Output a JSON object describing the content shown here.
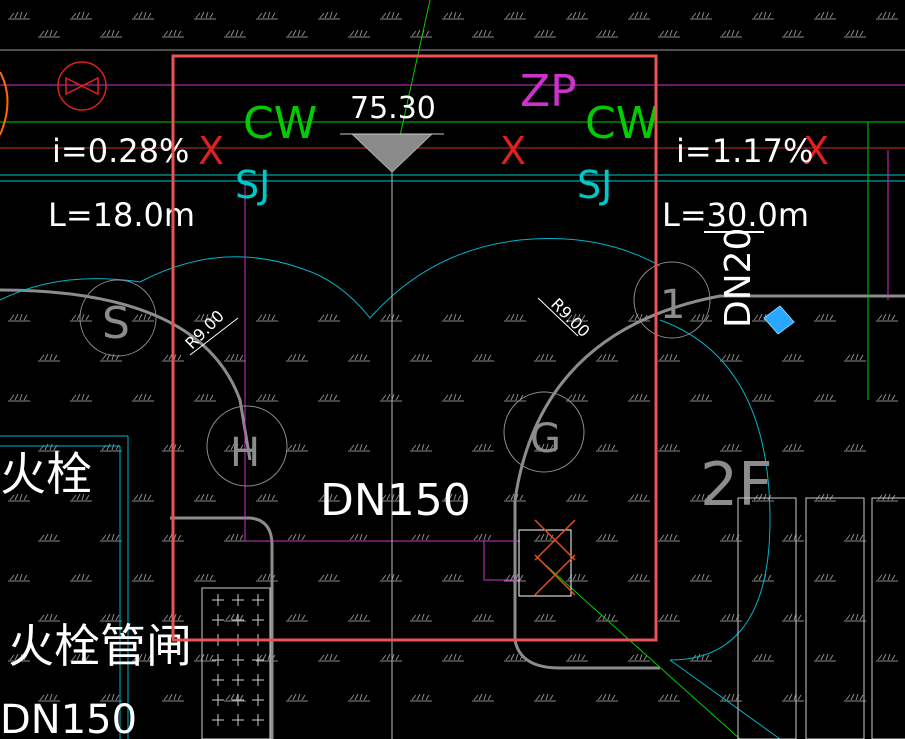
{
  "drawing": {
    "labels": {
      "zp": "ZP",
      "cw_left": "CW",
      "cw_right": "CW",
      "sj_left": "SJ",
      "sj_right": "SJ",
      "elevation": "75.30",
      "slope_left": "i=0.28%",
      "slope_right": "i=1.17%",
      "length_left": "L=18.0m",
      "length_right": "L=30.0m",
      "pipe_dn150": "DN150",
      "pipe_dn150_bottom": "DN150",
      "pipe_dn_vertical": "DN20",
      "radius_left": "R9.00",
      "radius_right": "R9.00",
      "hydrant_1": "火栓",
      "hydrant_2": "火栓管闸",
      "floor_label": "2F",
      "circle_s": "S",
      "circle_h": "H",
      "circle_g": "G",
      "circle_1": "1",
      "x_mark": "X"
    },
    "colors": {
      "background": "#000000",
      "selection_box": "#e85450",
      "cw_line": "#00cc00",
      "sj_line": "#00c8c8",
      "zp_line": "#cc33cc",
      "x_mark": "#e02020",
      "white_text": "#ffffff",
      "grey_road": "#8c8c8c",
      "cyan_arc": "#00b4c8",
      "accent_blue": "#2aa8ff"
    }
  }
}
